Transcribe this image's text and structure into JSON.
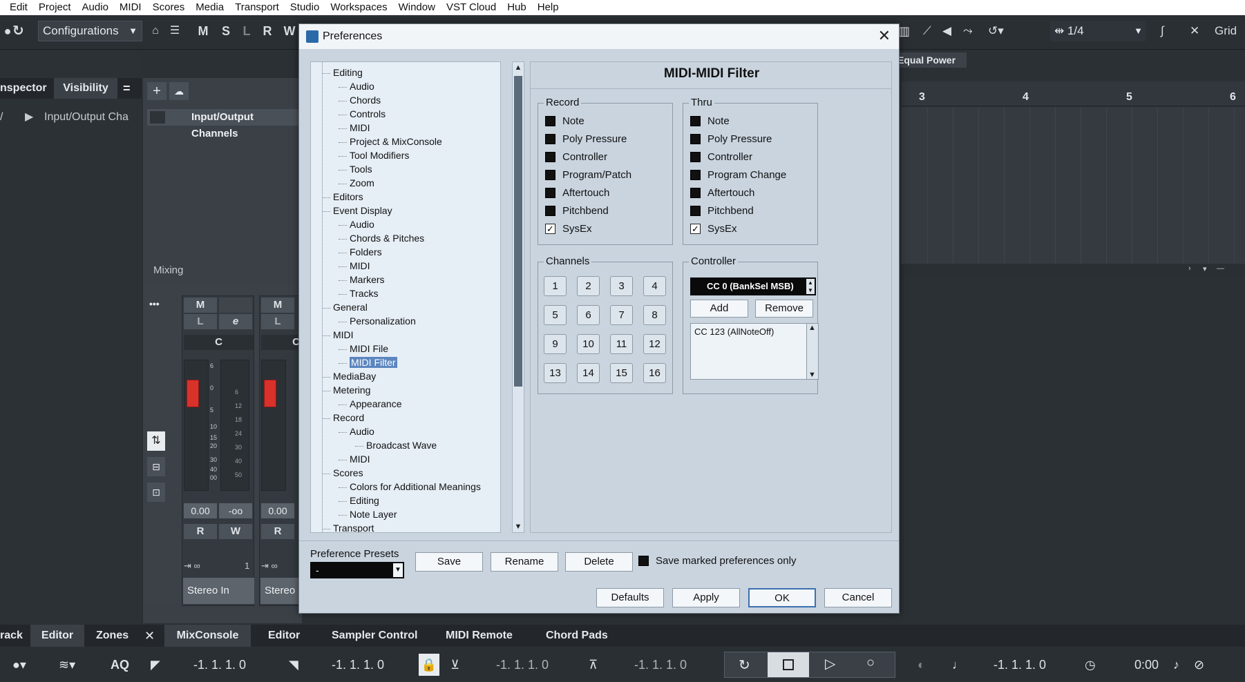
{
  "menubar": [
    "Edit",
    "Project",
    "Audio",
    "MIDI",
    "Scores",
    "Media",
    "Transport",
    "Studio",
    "Workspaces",
    "Window",
    "VST Cloud",
    "Hub",
    "Help"
  ],
  "toolbar": {
    "configurations": "Configurations",
    "btn_m": "M",
    "btn_s": "S",
    "btn_l": "L",
    "btn_r": "R",
    "btn_w": "W",
    "quantize": "1/4",
    "grid": "Grid",
    "equal_power": "Equal Power"
  },
  "inspector": {
    "tab_inspector": "nspector",
    "tab_visibility": "Visibility",
    "row": "Input/Output Cha",
    "menu_glyph": "="
  },
  "mixer": {
    "io_bar": "Input/Output Channels",
    "mixing_label": "Mixing",
    "more": "•••",
    "strip1": {
      "m": "M",
      "l": "L",
      "e": "e",
      "c": "C",
      "vol": "0.00",
      "pan": "-oo",
      "r": "R",
      "w": "W",
      "num": "1",
      "name": "Stereo In"
    },
    "strip2": {
      "m": "M",
      "l": "L",
      "c": "C",
      "vol": "0.00",
      "r": "R",
      "name": "Stereo O"
    },
    "scale": [
      "6",
      "0",
      "5",
      "10",
      "15",
      "20",
      "30",
      "40",
      "00"
    ],
    "scale2": [
      "6",
      "12",
      "18",
      "24",
      "30",
      "40",
      "50"
    ]
  },
  "ruler": [
    "3",
    "4",
    "5",
    "6"
  ],
  "bottom_tabs": [
    "rack",
    "Editor",
    "Zones",
    "MixConsole",
    "Editor",
    "Sampler Control",
    "MIDI Remote",
    "Chord Pads"
  ],
  "transport": {
    "aq": "AQ",
    "pos1": "-1. 1. 1.   0",
    "pos2": "-1. 1. 1.   0",
    "pos3": "-1. 1. 1.   0",
    "pos4": "-1. 1. 1.   0",
    "pos5": "-1. 1. 1.   0",
    "time": "0:00"
  },
  "dialog": {
    "title": "Preferences",
    "heading": "MIDI-MIDI Filter",
    "tree": [
      {
        "label": "Editing",
        "level": 1
      },
      {
        "label": "Audio",
        "level": 2
      },
      {
        "label": "Chords",
        "level": 2
      },
      {
        "label": "Controls",
        "level": 2
      },
      {
        "label": "MIDI",
        "level": 2
      },
      {
        "label": "Project & MixConsole",
        "level": 2
      },
      {
        "label": "Tool Modifiers",
        "level": 2
      },
      {
        "label": "Tools",
        "level": 2
      },
      {
        "label": "Zoom",
        "level": 2
      },
      {
        "label": "Editors",
        "level": 1
      },
      {
        "label": "Event Display",
        "level": 1
      },
      {
        "label": "Audio",
        "level": 2
      },
      {
        "label": "Chords & Pitches",
        "level": 2
      },
      {
        "label": "Folders",
        "level": 2
      },
      {
        "label": "MIDI",
        "level": 2
      },
      {
        "label": "Markers",
        "level": 2
      },
      {
        "label": "Tracks",
        "level": 2
      },
      {
        "label": "General",
        "level": 1
      },
      {
        "label": "Personalization",
        "level": 2
      },
      {
        "label": "MIDI",
        "level": 1
      },
      {
        "label": "MIDI File",
        "level": 2
      },
      {
        "label": "MIDI Filter",
        "level": 2,
        "selected": true
      },
      {
        "label": "MediaBay",
        "level": 1
      },
      {
        "label": "Metering",
        "level": 1
      },
      {
        "label": "Appearance",
        "level": 2
      },
      {
        "label": "Record",
        "level": 1
      },
      {
        "label": "Audio",
        "level": 2
      },
      {
        "label": "Broadcast Wave",
        "level": 3
      },
      {
        "label": "MIDI",
        "level": 2
      },
      {
        "label": "Scores",
        "level": 1
      },
      {
        "label": "Colors for Additional Meanings",
        "level": 2
      },
      {
        "label": "Editing",
        "level": 2
      },
      {
        "label": "Note Layer",
        "level": 2
      },
      {
        "label": "Transport",
        "level": 1
      }
    ],
    "record": {
      "legend": "Record",
      "items": [
        {
          "label": "Note",
          "checked": false
        },
        {
          "label": "Poly Pressure",
          "checked": false
        },
        {
          "label": "Controller",
          "checked": false
        },
        {
          "label": "Program/Patch",
          "checked": false
        },
        {
          "label": "Aftertouch",
          "checked": false
        },
        {
          "label": "Pitchbend",
          "checked": false
        },
        {
          "label": "SysEx",
          "checked": true
        }
      ]
    },
    "thru": {
      "legend": "Thru",
      "items": [
        {
          "label": "Note",
          "checked": false
        },
        {
          "label": "Poly Pressure",
          "checked": false
        },
        {
          "label": "Controller",
          "checked": false
        },
        {
          "label": "Program Change",
          "checked": false
        },
        {
          "label": "Aftertouch",
          "checked": false
        },
        {
          "label": "Pitchbend",
          "checked": false
        },
        {
          "label": "SysEx",
          "checked": true
        }
      ]
    },
    "channels": {
      "legend": "Channels",
      "buttons": [
        "1",
        "2",
        "3",
        "4",
        "5",
        "6",
        "7",
        "8",
        "9",
        "10",
        "11",
        "12",
        "13",
        "14",
        "15",
        "16"
      ]
    },
    "controller": {
      "legend": "Controller",
      "selected": "CC 0  (BankSel MSB)",
      "add": "Add",
      "remove": "Remove",
      "list": [
        "CC 123  (AllNoteOff)"
      ]
    },
    "presets": {
      "label": "Preference Presets",
      "value": "-",
      "save": "Save",
      "rename": "Rename",
      "delete": "Delete",
      "save_marked": "Save marked preferences only"
    },
    "buttons": {
      "defaults": "Defaults",
      "apply": "Apply",
      "ok": "OK",
      "cancel": "Cancel"
    }
  }
}
